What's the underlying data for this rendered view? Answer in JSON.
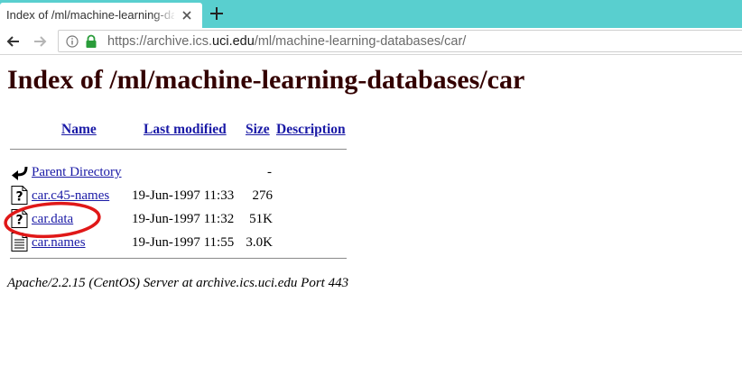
{
  "browser": {
    "tab_title": "Index of /ml/machine-learning-databases/car/",
    "url_prefix": "https://archive.ics.",
    "url_host": "uci.edu",
    "url_path": "/ml/machine-learning-databases/car/"
  },
  "page": {
    "title": "Index of /ml/machine-learning-databases/car",
    "columns": {
      "name": "Name",
      "last_modified": "Last modified",
      "size": "Size",
      "description": "Description"
    },
    "parent": {
      "name": "Parent Directory",
      "size": "-"
    },
    "files": [
      {
        "name": "car.c45-names",
        "modified": "19-Jun-1997 11:33",
        "size": "276",
        "icon": "unknown-file-icon"
      },
      {
        "name": "car.data",
        "modified": "19-Jun-1997 11:32",
        "size": "51K",
        "icon": "unknown-file-icon"
      },
      {
        "name": "car.names",
        "modified": "19-Jun-1997 11:55",
        "size": "3.0K",
        "icon": "text-file-icon"
      }
    ],
    "footer": "Apache/2.2.15 (CentOS) Server at archive.ics.uci.edu Port 443"
  },
  "colors": {
    "tab_bar": "#59cfcf",
    "title": "#330000",
    "link": "#1a1aa6",
    "annotation": "#e01818",
    "lock": "#2a9c3a"
  }
}
